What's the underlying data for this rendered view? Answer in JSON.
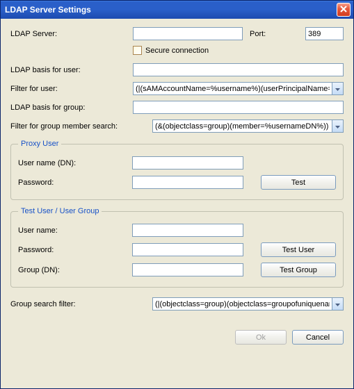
{
  "window": {
    "title": "LDAP Server Settings"
  },
  "main": {
    "ldap_server_label": "LDAP Server:",
    "ldap_server_value": "",
    "port_label": "Port:",
    "port_value": "389",
    "secure_connection_label": "Secure connection",
    "ldap_basis_user_label": "LDAP basis for user:",
    "ldap_basis_user_value": "",
    "filter_user_label": "Filter for user:",
    "filter_user_value": "(|(sAMAccountName=%username%)(userPrincipalName=%",
    "ldap_basis_group_label": "LDAP basis for group:",
    "ldap_basis_group_value": "",
    "filter_group_member_label": "Filter for group member search:",
    "filter_group_member_value": "(&(objectclass=group)(member=%usernameDN%))",
    "group_search_filter_label": "Group search filter:",
    "group_search_filter_value": "(|(objectclass=group)(objectclass=groupofuniquenames))"
  },
  "proxy": {
    "legend": "Proxy User",
    "username_label": "User name (DN):",
    "username_value": "",
    "password_label": "Password:",
    "password_value": "",
    "test_button": "Test"
  },
  "test": {
    "legend": "Test User / User Group",
    "username_label": "User name:",
    "username_value": "",
    "password_label": "Password:",
    "password_value": "",
    "group_label": "Group (DN):",
    "group_value": "",
    "test_user_button": "Test User",
    "test_group_button": "Test Group"
  },
  "footer": {
    "ok": "Ok",
    "cancel": "Cancel"
  }
}
